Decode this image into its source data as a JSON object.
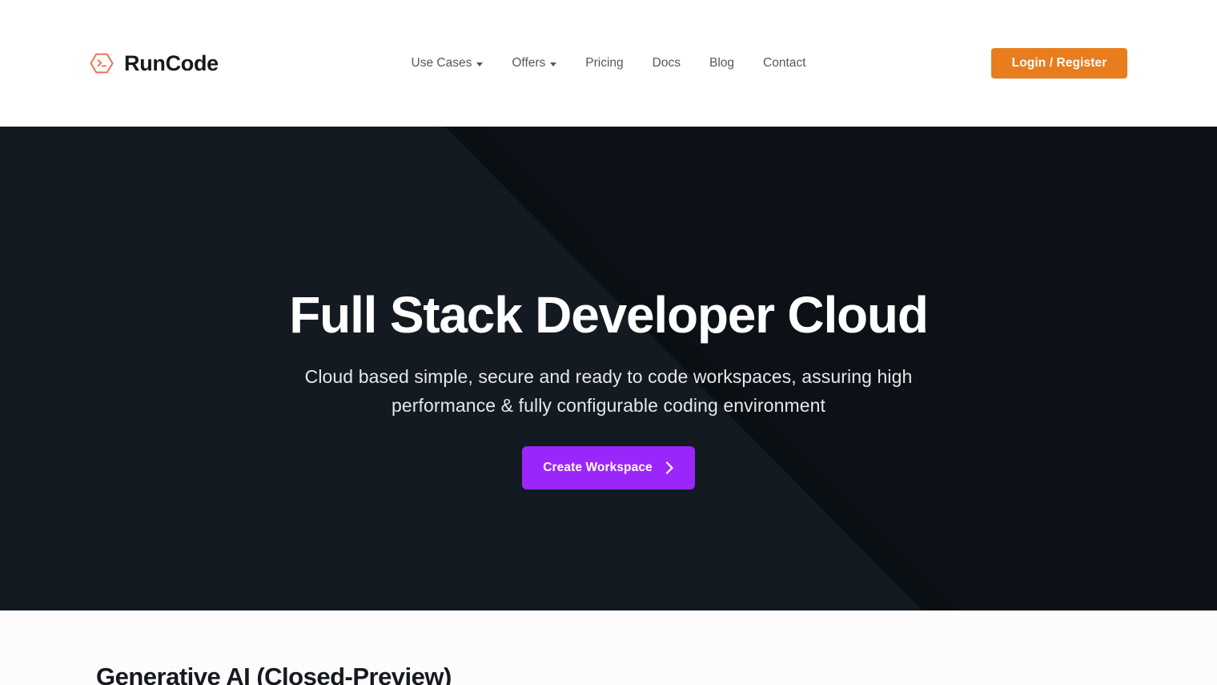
{
  "brand": {
    "name": "RunCode",
    "logo_icon": "hexagon-terminal-prompt-icon",
    "logo_color": "#f2704b"
  },
  "header": {
    "nav": [
      {
        "label": "Use Cases",
        "has_dropdown": true,
        "name": "use-cases"
      },
      {
        "label": "Offers",
        "has_dropdown": true,
        "name": "offers"
      },
      {
        "label": "Pricing",
        "has_dropdown": false,
        "name": "pricing"
      },
      {
        "label": "Docs",
        "has_dropdown": false,
        "name": "docs"
      },
      {
        "label": "Blog",
        "has_dropdown": false,
        "name": "blog"
      },
      {
        "label": "Contact",
        "has_dropdown": false,
        "name": "contact"
      }
    ],
    "login_button": {
      "label": "Login / Register",
      "color": "#e77d1d"
    }
  },
  "hero": {
    "title": "Full Stack Developer Cloud",
    "subtitle": "Cloud based simple, secure and ready to code workspaces, assuring high performance & fully configurable coding environment",
    "cta": {
      "label": "Create Workspace",
      "icon": "chevron-right-icon",
      "color": "#9b26fb"
    },
    "background_color": "#131a22",
    "accent_band_color": "#0b1015"
  },
  "sections": [
    {
      "heading": "Generative AI (Closed-Preview)",
      "name": "generative-ai"
    }
  ]
}
